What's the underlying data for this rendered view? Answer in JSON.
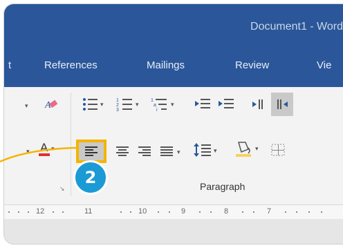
{
  "window": {
    "title": "Document1  -  Word"
  },
  "tabs": [
    {
      "label": "t"
    },
    {
      "label": "References"
    },
    {
      "label": "Mailings"
    },
    {
      "label": "Review"
    },
    {
      "label": "Vie"
    }
  ],
  "ribbon": {
    "paragraph_group_label": "Paragraph",
    "selected_button": "align-left"
  },
  "callout": {
    "number": "2",
    "color": "#1b9ad6"
  },
  "ruler": {
    "numbers": [
      "12",
      "11",
      "10",
      "9",
      "8",
      "7"
    ]
  },
  "colors": {
    "title_bar": "#2b579a",
    "highlight": "#f4b400",
    "font_color": "#e3302f"
  }
}
